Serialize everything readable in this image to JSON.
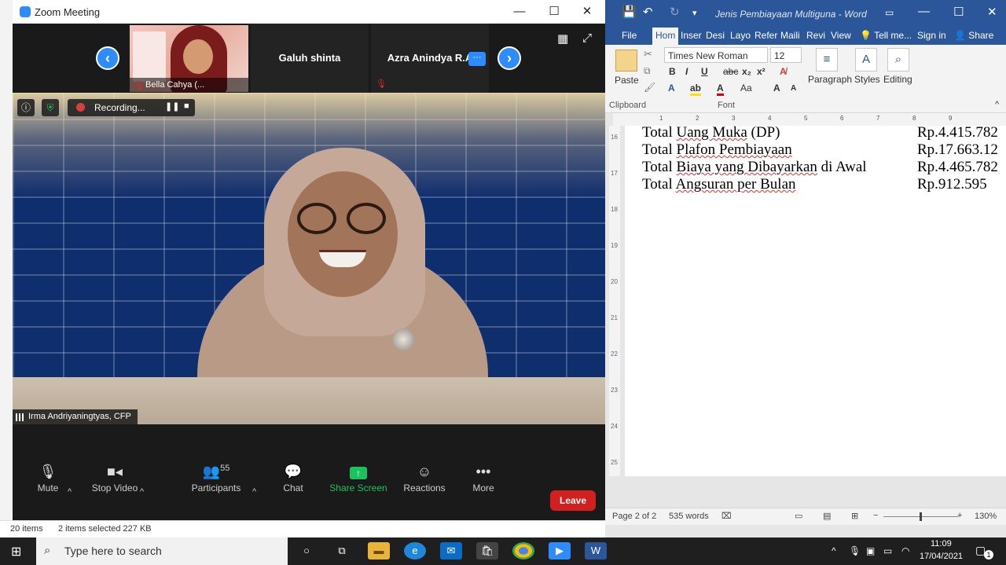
{
  "zoom": {
    "title": "Zoom Meeting",
    "participants_strip": [
      {
        "name": "Bella Cahya (...",
        "muted": true
      },
      {
        "name": "Galuh shinta",
        "muted": false
      },
      {
        "name": "Azra Anindya R.A",
        "muted": true
      }
    ],
    "more_dots": "···",
    "recording_label": "Recording...",
    "active_speaker": "Irma Andriyaningtyas, CFP",
    "controls": {
      "mute": "Mute",
      "stop_video": "Stop Video",
      "participants": "Participants",
      "participants_count": "55",
      "chat": "Chat",
      "share_screen": "Share Screen",
      "reactions": "Reactions",
      "more": "More",
      "leave": "Leave"
    },
    "colors": {
      "accent": "#2d8cff",
      "leave": "#d02020",
      "share": "#1ac35c"
    }
  },
  "word": {
    "doc_title": "Jenis Pembiayaan Multiguna - Word",
    "tabs": [
      "File",
      "Hom",
      "Inser",
      "Desi",
      "Layo",
      "Refer",
      "Maili",
      "Revi",
      "View"
    ],
    "tell_me": "Tell me...",
    "sign_in": "Sign in",
    "share": "Share",
    "ribbon": {
      "paste": "Paste",
      "clipboard": "Clipboard",
      "font_name": "Times New Roman",
      "font_size": "12",
      "font_group": "Font",
      "paragraph": "Paragraph",
      "styles": "Styles",
      "editing": "Editing"
    },
    "ruler_numbers": [
      "1",
      "2",
      "3",
      "4",
      "5",
      "6",
      "7",
      "8",
      "9"
    ],
    "vruler_numbers": [
      "16",
      "17",
      "18",
      "19",
      "20",
      "21",
      "22",
      "23",
      "24",
      "25"
    ],
    "rows": [
      {
        "label_plain": "Total ",
        "label_squiggle": "Uang Muka",
        "label_rest": " (DP)",
        "value": "Rp.4.415.782"
      },
      {
        "label_plain": "Total ",
        "label_squiggle": "Plafon Pembiayaan",
        "label_rest": "",
        "value": "Rp.17.663.12"
      },
      {
        "label_plain": "Total ",
        "label_squiggle": "Biaya yang Dibayarkan",
        "label_rest": " di Awal",
        "value": "Rp.4.465.782"
      },
      {
        "label_plain": "Total ",
        "label_squiggle": "Angsuran per Bulan",
        "label_rest": "",
        "value": "Rp.912.595"
      }
    ],
    "status": {
      "page": "Page 2 of 2",
      "words": "535 words",
      "zoom": "130%"
    },
    "colors": {
      "brand": "#2b579a"
    }
  },
  "explorer": {
    "items": "20 items",
    "selected": "2 items selected  227 KB"
  },
  "taskbar": {
    "search_placeholder": "Type here to search",
    "time": "11:09",
    "date": "17/04/2021",
    "notifications": "1"
  }
}
